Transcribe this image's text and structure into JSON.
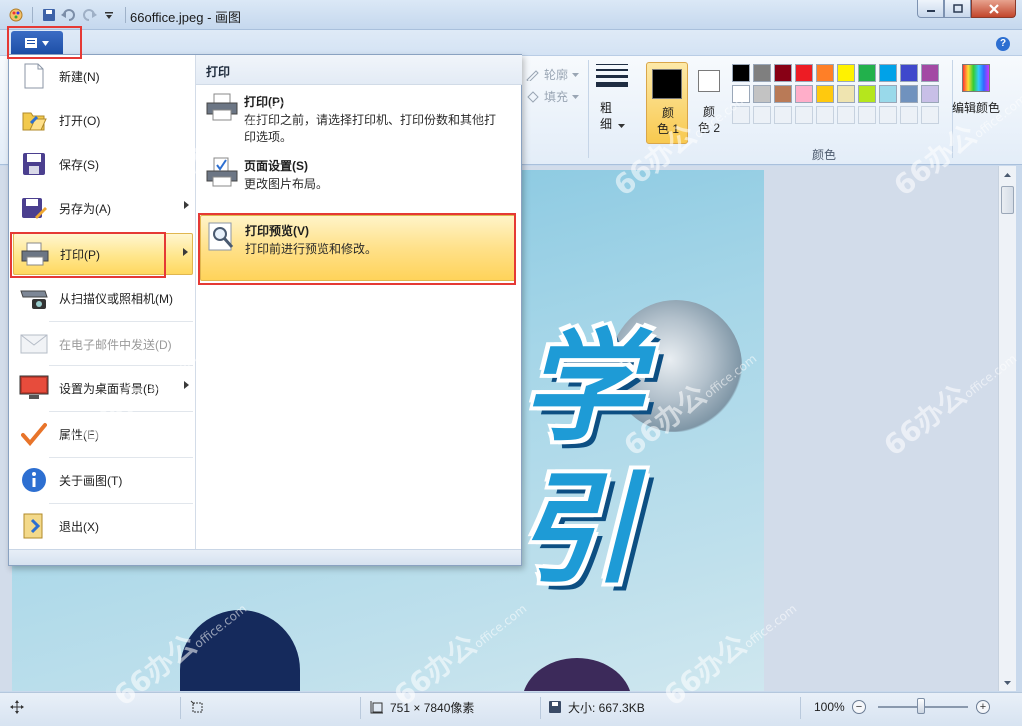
{
  "window": {
    "title": "66office.jpeg - 画图"
  },
  "ribbon": {
    "outline_label": "轮廓",
    "fill_label": "填充",
    "thickness_label": "粗\n细",
    "color1_label": "颜\n色 1",
    "color2_label": "颜\n色 2",
    "colors_group_label": "颜色",
    "edit_colors_label": "编辑颜色",
    "palette": [
      "#000000",
      "#7f7f7f",
      "#880015",
      "#ed1c24",
      "#ff7f27",
      "#fff200",
      "#22b14c",
      "#00a2e8",
      "#3f48cc",
      "#a349a4",
      "#ffffff",
      "#c3c3c3",
      "#b97a57",
      "#ffaec9",
      "#ffc90e",
      "#efe4b0",
      "#b5e61d",
      "#99d9ea",
      "#7092be",
      "#c8bfe7"
    ],
    "color1": "#000000",
    "color2": "#ffffff"
  },
  "file_menu": {
    "items": [
      {
        "label": "新建(N)",
        "icon": "new-document-icon"
      },
      {
        "label": "打开(O)",
        "icon": "open-folder-icon"
      },
      {
        "label": "保存(S)",
        "icon": "save-disk-icon"
      },
      {
        "label": "另存为(A)",
        "icon": "save-as-icon"
      },
      {
        "label": "打印(P)",
        "icon": "printer-icon"
      },
      {
        "label": "从扫描仪或照相机(M)",
        "icon": "scanner-icon"
      },
      {
        "label": "在电子邮件中发送(D)",
        "icon": "email-icon"
      },
      {
        "label": "设置为桌面背景(B)",
        "icon": "desktop-icon"
      },
      {
        "label": "属性(E)",
        "icon": "checkmark-icon"
      },
      {
        "label": "关于画图(T)",
        "icon": "info-icon"
      },
      {
        "label": "退出(X)",
        "icon": "exit-icon"
      }
    ]
  },
  "print_submenu": {
    "header": "打印",
    "items": [
      {
        "title": "打印(P)",
        "desc": "在打印之前，请选择打印机、打印份数和其他打印选项。"
      },
      {
        "title": "页面设置(S)",
        "desc": "更改图片布局。"
      },
      {
        "title": "打印预览(V)",
        "desc": "打印前进行预览和修改。"
      }
    ]
  },
  "canvas": {
    "char1": "学",
    "char2": "引"
  },
  "statusbar": {
    "dimensions": "751 × 7840像素",
    "size": "大小: 667.3KB",
    "zoom": "100%"
  },
  "watermark": {
    "text": "66办公",
    "sub": "office.com"
  }
}
